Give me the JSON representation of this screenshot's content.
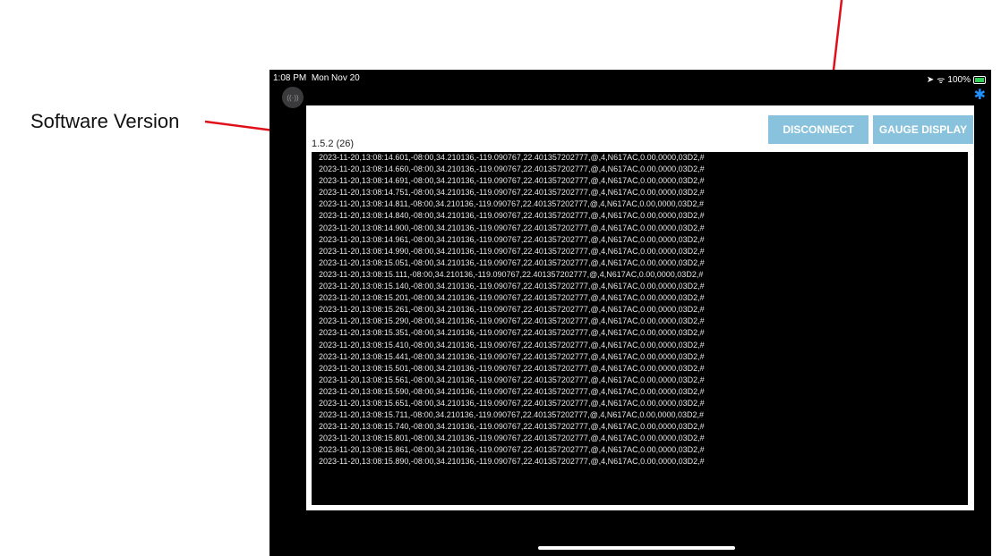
{
  "annotations": {
    "software_version_label": "Software Version"
  },
  "status_bar": {
    "time": "1:08 PM",
    "date": "Mon Nov 20",
    "battery": "100%"
  },
  "toolbar": {
    "disconnect_label": "DISCONNECT",
    "gauge_display_label": "GAUGE DISPLAY"
  },
  "app": {
    "version": "1.5.2 (26)",
    "broadcast_glyph": "((·))"
  },
  "colors": {
    "button_bg": "#89c2dc",
    "log_bg": "#000000",
    "bluetooth": "#1e90ff",
    "arrow": "#e0101a"
  },
  "icons": [
    "broadcast-icon",
    "bluetooth-icon",
    "location-icon",
    "wifi-icon",
    "battery-icon"
  ],
  "log": {
    "lines": [
      "2023-11-20,13:08:14.601,-08:00,34.210136,-119.090767,22.401357202777,@,4,N617AC,0.00,0000,03D2,#",
      "2023-11-20,13:08:14.660,-08:00,34.210136,-119.090767,22.401357202777,@,4,N617AC,0.00,0000,03D2,#",
      "2023-11-20,13:08:14.691,-08:00,34.210136,-119.090767,22.401357202777,@,4,N617AC,0.00,0000,03D2,#",
      "2023-11-20,13:08:14.751,-08:00,34.210136,-119.090767,22.401357202777,@,4,N617AC,0.00,0000,03D2,#",
      "2023-11-20,13:08:14.811,-08:00,34.210136,-119.090767,22.401357202777,@,4,N617AC,0.00,0000,03D2,#",
      "2023-11-20,13:08:14.840,-08:00,34.210136,-119.090767,22.401357202777,@,4,N617AC,0.00,0000,03D2,#",
      "2023-11-20,13:08:14.900,-08:00,34.210136,-119.090767,22.401357202777,@,4,N617AC,0.00,0000,03D2,#",
      "2023-11-20,13:08:14.961,-08:00,34.210136,-119.090767,22.401357202777,@,4,N617AC,0.00,0000,03D2,#",
      "2023-11-20,13:08:14.990,-08:00,34.210136,-119.090767,22.401357202777,@,4,N617AC,0.00,0000,03D2,#",
      "2023-11-20,13:08:15.051,-08:00,34.210136,-119.090767,22.401357202777,@,4,N617AC,0.00,0000,03D2,#",
      "2023-11-20,13:08:15.111,-08:00,34.210136,-119.090767,22.401357202777,@,4,N617AC,0.00,0000,03D2,#",
      "2023-11-20,13:08:15.140,-08:00,34.210136,-119.090767,22.401357202777,@,4,N617AC,0.00,0000,03D2,#",
      "2023-11-20,13:08:15.201,-08:00,34.210136,-119.090767,22.401357202777,@,4,N617AC,0.00,0000,03D2,#",
      "2023-11-20,13:08:15.261,-08:00,34.210136,-119.090767,22.401357202777,@,4,N617AC,0.00,0000,03D2,#",
      "2023-11-20,13:08:15.290,-08:00,34.210136,-119.090767,22.401357202777,@,4,N617AC,0.00,0000,03D2,#",
      "2023-11-20,13:08:15.351,-08:00,34.210136,-119.090767,22.401357202777,@,4,N617AC,0.00,0000,03D2,#",
      "2023-11-20,13:08:15.410,-08:00,34.210136,-119.090767,22.401357202777,@,4,N617AC,0.00,0000,03D2,#",
      "2023-11-20,13:08:15.441,-08:00,34.210136,-119.090767,22.401357202777,@,4,N617AC,0.00,0000,03D2,#",
      "2023-11-20,13:08:15.501,-08:00,34.210136,-119.090767,22.401357202777,@,4,N617AC,0.00,0000,03D2,#",
      "2023-11-20,13:08:15.561,-08:00,34.210136,-119.090767,22.401357202777,@,4,N617AC,0.00,0000,03D2,#",
      "2023-11-20,13:08:15.590,-08:00,34.210136,-119.090767,22.401357202777,@,4,N617AC,0.00,0000,03D2,#",
      "2023-11-20,13:08:15.651,-08:00,34.210136,-119.090767,22.401357202777,@,4,N617AC,0.00,0000,03D2,#",
      "2023-11-20,13:08:15.711,-08:00,34.210136,-119.090767,22.401357202777,@,4,N617AC,0.00,0000,03D2,#",
      "2023-11-20,13:08:15.740,-08:00,34.210136,-119.090767,22.401357202777,@,4,N617AC,0.00,0000,03D2,#",
      "2023-11-20,13:08:15.801,-08:00,34.210136,-119.090767,22.401357202777,@,4,N617AC,0.00,0000,03D2,#",
      "2023-11-20,13:08:15.861,-08:00,34.210136,-119.090767,22.401357202777,@,4,N617AC,0.00,0000,03D2,#",
      "2023-11-20,13:08:15.890,-08:00,34.210136,-119.090767,22.401357202777,@,4,N617AC,0.00,0000,03D2,#"
    ]
  }
}
